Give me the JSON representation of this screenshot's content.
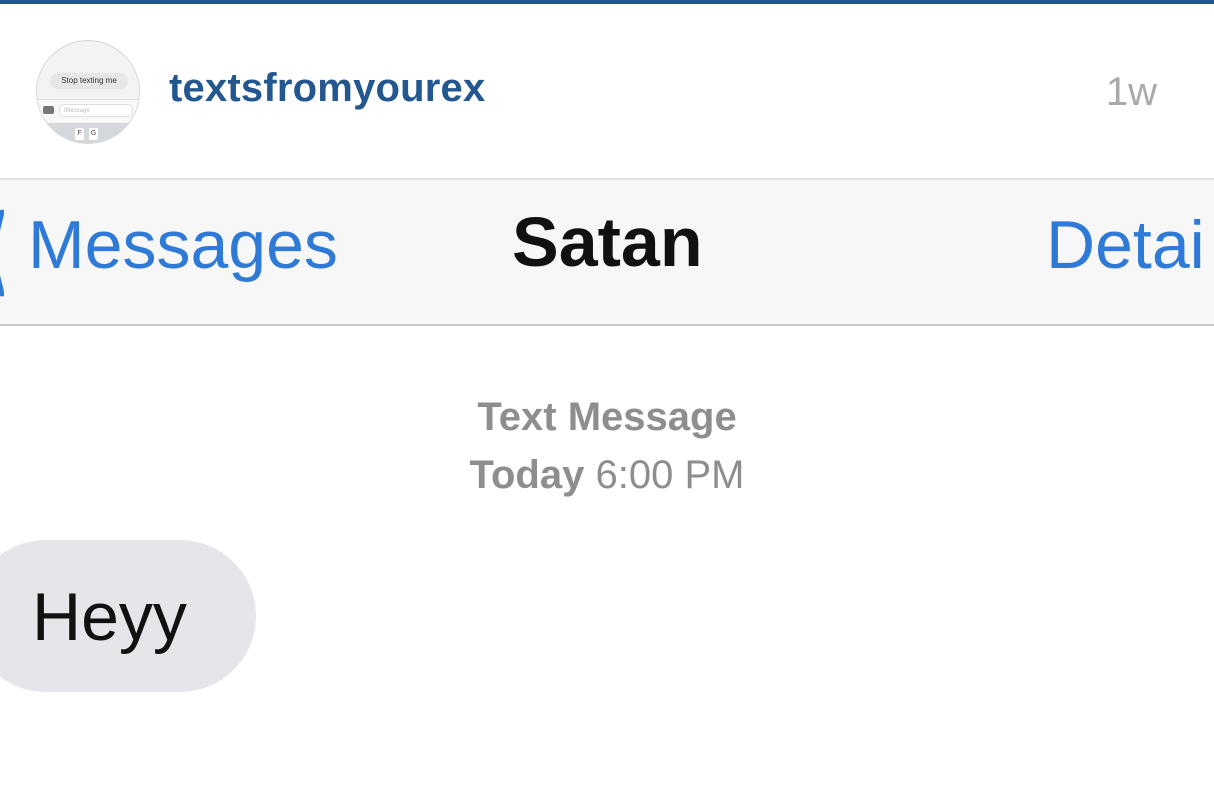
{
  "post": {
    "username": "textsfromyourex",
    "age": "1w",
    "avatar": {
      "bubble_text": "Stop texting me",
      "input_placeholder": "iMessage",
      "keys": [
        "F",
        "G"
      ]
    }
  },
  "nav": {
    "back_label": "Messages",
    "title": "Satan",
    "details_label": "Detai"
  },
  "conversation": {
    "service_label": "Text Message",
    "day_label": "Today",
    "time_label": "6:00 PM",
    "messages": [
      {
        "text": "Heyy",
        "direction": "incoming"
      }
    ]
  },
  "colors": {
    "brand_blue": "#23578f",
    "ios_blue": "#2e7ad6",
    "incoming_bubble": "#e5e5ea",
    "meta_gray": "#8e8e8e"
  }
}
